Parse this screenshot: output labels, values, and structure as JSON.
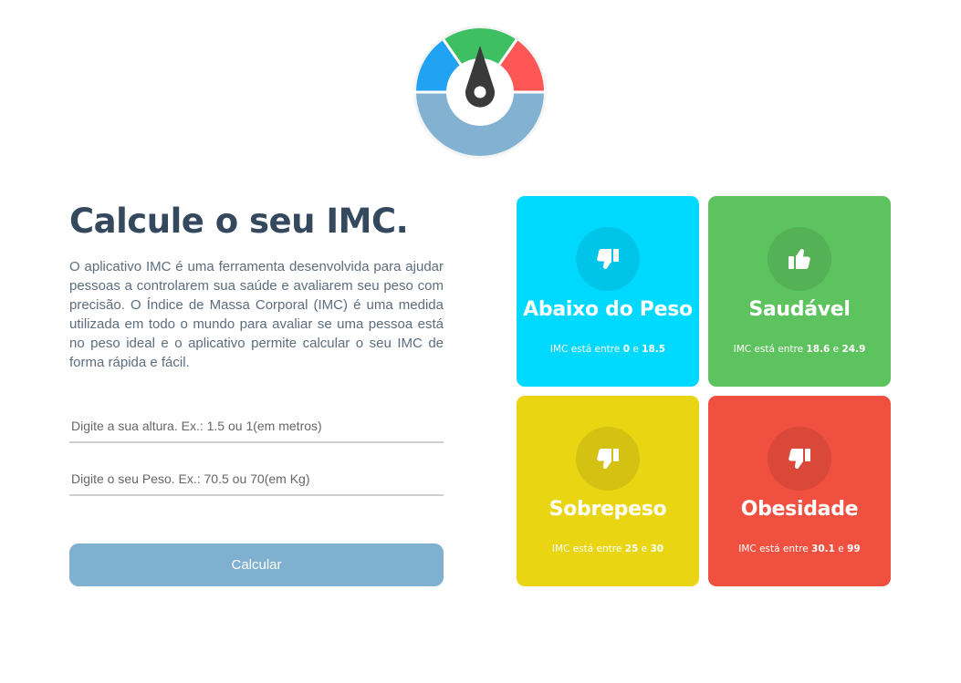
{
  "logo": {
    "name": "bmi-gauge-logo"
  },
  "main": {
    "title": "Calcule o seu IMC.",
    "description": "O aplicativo IMC é uma ferramenta desenvolvida para ajudar pessoas a controlarem sua saúde e avaliarem seu peso com precisão. O Índice de Massa Corporal (IMC) é uma medida utilizada em todo o mundo para avaliar se uma pessoa está no peso ideal e o aplicativo permite calcular o seu IMC de forma rápida e fácil."
  },
  "form": {
    "altura_placeholder": "Digite a sua altura. Ex.: 1.5 ou 1(em metros)",
    "altura_value": "",
    "peso_placeholder": "Digite o seu Peso. Ex.: 70.5 ou 70(em Kg)",
    "peso_value": "",
    "button_label": "Calcular"
  },
  "cards": [
    {
      "label": "Abaixo do Peso",
      "prefix": "IMC está entre",
      "min": "0",
      "conj": "e",
      "max": "18.5",
      "icon": "thumbs-down-icon",
      "color": "#00d9ff"
    },
    {
      "label": "Saudável",
      "prefix": "IMC está entre",
      "min": "18.6",
      "conj": "e",
      "max": "24.9",
      "icon": "thumbs-up-icon",
      "color": "#5dc35f"
    },
    {
      "label": "Sobrepeso",
      "prefix": "IMC está entre",
      "min": "25",
      "conj": "e",
      "max": "30",
      "icon": "thumbs-down-icon",
      "color": "#ead513"
    },
    {
      "label": "Obesidade",
      "prefix": "IMC está entre",
      "min": "30.1",
      "conj": "e",
      "max": "99",
      "icon": "thumbs-down-icon",
      "color": "#f0503f"
    }
  ],
  "colors": {
    "title": "#34495e",
    "button": "#7fb0d0",
    "gauge_blue": "#1fa3f2",
    "gauge_green": "#3ebf61",
    "gauge_red": "#ff5656",
    "gauge_base": "#82b1d1"
  }
}
